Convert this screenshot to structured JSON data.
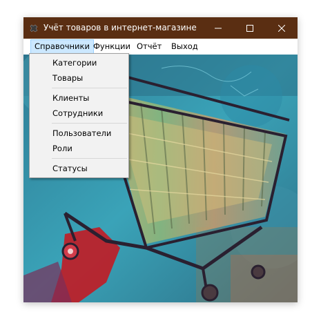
{
  "window": {
    "title": "Учёт товаров в интернет-магазине",
    "title_bar_color": "#5a2e12"
  },
  "titlebar_buttons": {
    "minimize_icon": "minimize-icon",
    "maximize_icon": "maximize-icon",
    "close_icon": "close-icon"
  },
  "menubar": {
    "items": [
      {
        "label": "Справочники",
        "active": true
      },
      {
        "label": "Функции"
      },
      {
        "label": "Отчёт"
      },
      {
        "label": "Выход"
      }
    ]
  },
  "dropdown": {
    "groups": [
      [
        "Категории",
        "Товары"
      ],
      [
        "Клиенты",
        "Сотрудники"
      ],
      [
        "Пользователи",
        "Роли"
      ],
      [
        "Статусы"
      ]
    ]
  },
  "background": {
    "description_icon": "shopping-cart-painting"
  }
}
